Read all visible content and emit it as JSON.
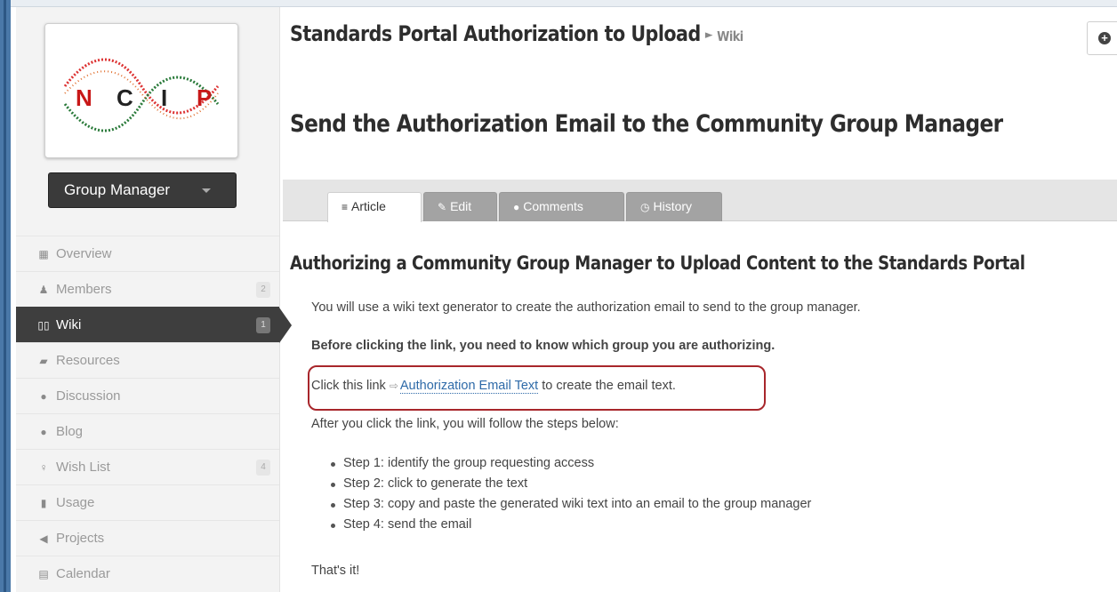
{
  "sidebar": {
    "logo_letters": [
      "N",
      "C",
      "I",
      "P"
    ],
    "group_button_label": "Group Manager",
    "items": [
      {
        "label": "Overview",
        "icon": "grid-icon",
        "glyph": "▦",
        "count": ""
      },
      {
        "label": "Members",
        "icon": "user-icon",
        "glyph": "♟",
        "count": "2"
      },
      {
        "label": "Wiki",
        "icon": "book-icon",
        "glyph": "▯▯",
        "count": "1",
        "active": true
      },
      {
        "label": "Resources",
        "icon": "document-icon",
        "glyph": "▰",
        "count": ""
      },
      {
        "label": "Discussion",
        "icon": "chat-icon",
        "glyph": "●",
        "count": ""
      },
      {
        "label": "Blog",
        "icon": "comment-icon",
        "glyph": "●",
        "count": ""
      },
      {
        "label": "Wish List",
        "icon": "bulb-icon",
        "glyph": "♀",
        "count": "4"
      },
      {
        "label": "Usage",
        "icon": "bar-chart-icon",
        "glyph": "▮",
        "count": ""
      },
      {
        "label": "Projects",
        "icon": "send-icon",
        "glyph": "◀",
        "count": ""
      },
      {
        "label": "Calendar",
        "icon": "calendar-icon",
        "glyph": "▤",
        "count": ""
      }
    ]
  },
  "header": {
    "title": "Standards Portal Authorization to Upload",
    "breadcrumb_wiki": "Wiki"
  },
  "page": {
    "title": "Send the Authorization Email to the Community Group Manager"
  },
  "tabs": [
    {
      "label": "Article",
      "icon": "article-icon",
      "glyph": "≡",
      "active": true
    },
    {
      "label": "Edit",
      "icon": "pencil-icon",
      "glyph": "✎",
      "active": false
    },
    {
      "label": "Comments",
      "icon": "comments-icon",
      "glyph": "●",
      "active": false
    },
    {
      "label": "History",
      "icon": "clock-icon",
      "glyph": "◷",
      "active": false
    }
  ],
  "article": {
    "heading": "Authorizing a Community Group Manager to Upload Content to the Standards Portal",
    "intro": "You will use a wiki text generator to create the authorization email to send to the group manager.",
    "prereq": "Before clicking the link, you need to know which group you are authorizing.",
    "click_prefix": "Click this link ",
    "link_text": "Authorization Email Text",
    "click_suffix": " to create the email text.",
    "after": "After you click the link, you will follow the steps below:",
    "steps": [
      "Step 1: identify the group requesting access",
      "Step 2: click to generate the text",
      "Step 3: copy and paste the generated wiki text into an email to the group manager",
      "Step 4: send the email"
    ],
    "closing": "That's it!"
  },
  "colors": {
    "highlight": "#a8262b",
    "link": "#2e6aa8",
    "active_nav": "#3e3e3e"
  }
}
